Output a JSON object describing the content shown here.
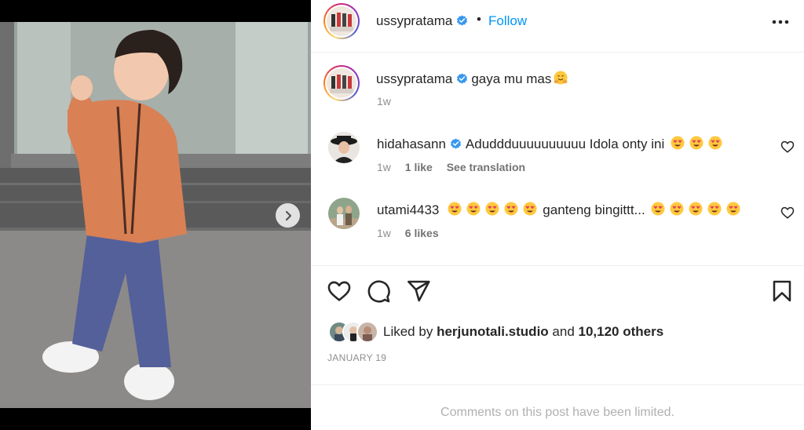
{
  "post": {
    "username": "ussypratama",
    "follow_label": "Follow",
    "separator": "•",
    "caption": {
      "username": "ussypratama",
      "text": "gaya mu mas",
      "emoji": "hugging-face",
      "time": "1w"
    },
    "comments": [
      {
        "username": "hidahasann",
        "verified": true,
        "text_before": "Aduddduuuuuuuuuu Idola onty ini",
        "text_after": "",
        "time": "1w",
        "likes": "1 like",
        "translation": "See translation"
      },
      {
        "username": "utami4433",
        "verified": false,
        "text_before": "",
        "text_middle": "ganteng bingittt...",
        "time": "1w",
        "likes": "6 likes"
      }
    ],
    "liked_by": {
      "prefix": "Liked by",
      "user": "herjunotali.studio",
      "conjunction": "and",
      "others": "10,120 others"
    },
    "date": "JANUARY 19",
    "comments_limited": "Comments on this post have been limited."
  },
  "colors": {
    "accent": "#0095f6",
    "verified": "#3897f0",
    "muted": "#8e8e8e",
    "text": "#262626"
  },
  "icons": {
    "verified": "verified-badge-icon",
    "more": "more-options-icon",
    "next": "chevron-right-icon",
    "like": "heart-icon",
    "comment": "comment-bubble-icon",
    "share": "paper-plane-icon",
    "save": "bookmark-icon"
  }
}
